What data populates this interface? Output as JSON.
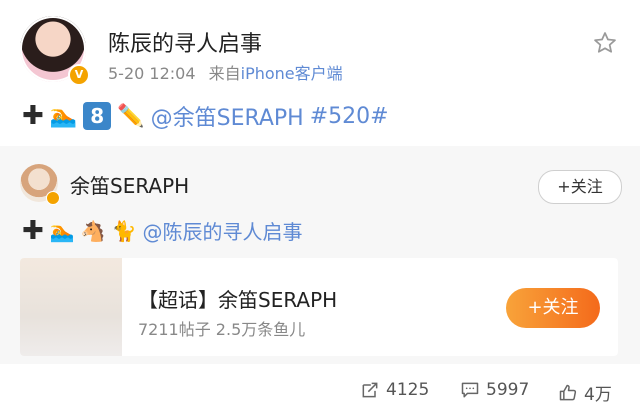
{
  "post": {
    "username": "陈辰的寻人启事",
    "time": "5-20 12:04",
    "source_prefix": "来自",
    "source": "iPhone客户端",
    "content_tokens": [
      {
        "type": "emoji",
        "name": "plus-symbol",
        "text": "✚"
      },
      {
        "type": "emoji",
        "name": "swimmer-emoji",
        "text": "🏊"
      },
      {
        "type": "emoji",
        "name": "keycap-eight-emoji",
        "text": "8"
      },
      {
        "type": "emoji",
        "name": "pencil-emoji",
        "text": "✏️"
      },
      {
        "type": "link",
        "text": "@余笛SERAPH"
      },
      {
        "type": "link",
        "text": " #520#"
      }
    ]
  },
  "repost": {
    "author": "余笛SERAPH",
    "follow_label": "+关注",
    "content_tokens": [
      {
        "type": "emoji",
        "name": "plus-symbol",
        "text": "✚"
      },
      {
        "type": "emoji",
        "name": "swimmer-emoji",
        "text": "🏊"
      },
      {
        "type": "emoji",
        "name": "horse-emoji",
        "text": "🐴"
      },
      {
        "type": "emoji",
        "name": "cat-emoji",
        "text": "🐈"
      },
      {
        "type": "link",
        "text": "@陈辰的寻人启事"
      }
    ],
    "card": {
      "title": "【超话】余笛SERAPH",
      "subtitle": "7211帖子 2.5万条鱼儿",
      "follow_label": "+关注"
    }
  },
  "actions": {
    "repost_count": "4125",
    "comment_count": "5997",
    "like_count": "4万"
  },
  "colors": {
    "link": "#5f8ad4",
    "accent_orange": "#f46a1b",
    "badge": "#f4a300"
  }
}
